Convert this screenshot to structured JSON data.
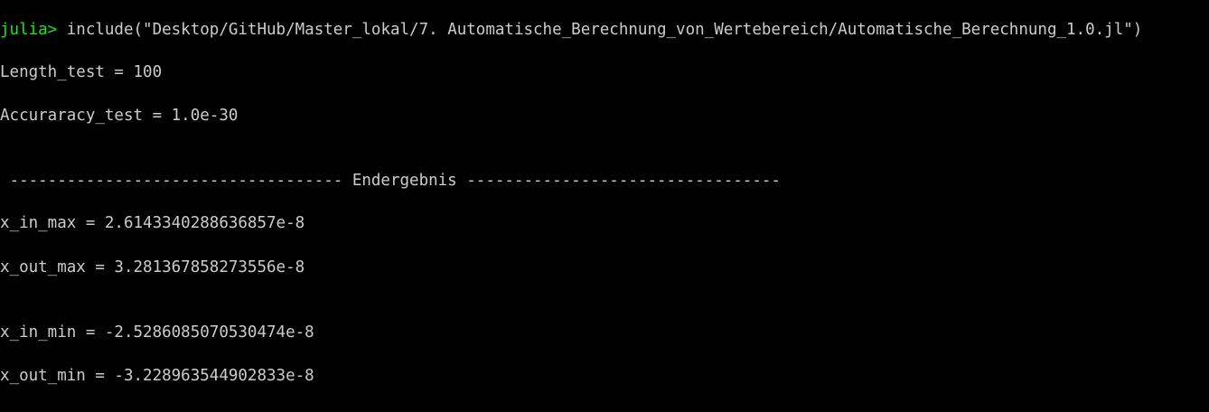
{
  "terminal": {
    "prompt": "julia>",
    "command": " include(\"Desktop/GitHub/Master_lokal/7. Automatische_Berechnung_von_Wertebereich/Automatische_Berechnung_1.0.jl\")",
    "output": {
      "length_test": "Length_test = 100",
      "accuracy_test": "Accuraracy_test = 1.0e-30",
      "section_header": " ----------------------------------- Endergebnis ---------------------------------",
      "x_in_max": "x_in_max = 2.6143340288636857e-8",
      "x_out_max": "x_out_max = 3.281367858273556e-8",
      "x_in_min": "x_in_min = -2.5286085070530474e-8",
      "x_out_min": "x_out_min = -3.228963544902833e-8"
    },
    "colors": {
      "background": "#000000",
      "text": "#cccccc",
      "prompt": "#13e813"
    }
  }
}
